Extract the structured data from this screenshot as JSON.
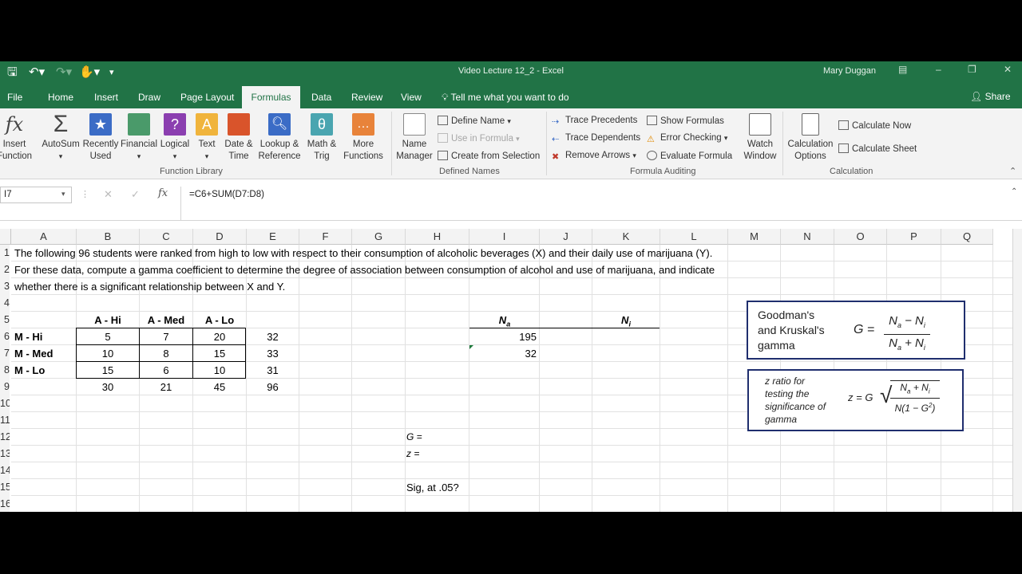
{
  "window": {
    "title": "Video Lecture 12_2 - Excel",
    "user": "Mary Duggan",
    "share_label": "Share",
    "tell_me": "Tell me what you want to do"
  },
  "tabs": [
    "File",
    "Home",
    "Insert",
    "Draw",
    "Page Layout",
    "Formulas",
    "Data",
    "Review",
    "View"
  ],
  "active_tab": "Formulas",
  "ribbon": {
    "function_library": {
      "label": "Function Library",
      "insert_function": "Insert\nFunction",
      "autosum": "AutoSum",
      "recently_used": "Recently\nUsed",
      "financial": "Financial",
      "logical": "Logical",
      "text": "Text",
      "date_time": "Date &\nTime",
      "lookup_reference": "Lookup &\nReference",
      "math_trig": "Math &\nTrig",
      "more_functions": "More\nFunctions"
    },
    "defined_names": {
      "label": "Defined Names",
      "name_manager": "Name\nManager",
      "define_name": "Define Name",
      "use_in_formula": "Use in Formula",
      "create_from_selection": "Create from Selection"
    },
    "formula_auditing": {
      "label": "Formula Auditing",
      "trace_precedents": "Trace Precedents",
      "trace_dependents": "Trace Dependents",
      "remove_arrows": "Remove Arrows",
      "show_formulas": "Show Formulas",
      "error_checking": "Error Checking",
      "evaluate_formula": "Evaluate Formula",
      "watch_window": "Watch\nWindow"
    },
    "calculation": {
      "label": "Calculation",
      "calculation_options": "Calculation\nOptions",
      "calculate_now": "Calculate Now",
      "calculate_sheet": "Calculate Sheet"
    }
  },
  "formula_bar": {
    "name_box": "I7",
    "formula": "=C6+SUM(D7:D8)",
    "fx": "fx"
  },
  "columns": [
    "A",
    "B",
    "C",
    "D",
    "E",
    "F",
    "G",
    "H",
    "I",
    "J",
    "K",
    "L",
    "M",
    "N",
    "O",
    "P",
    "Q"
  ],
  "rows": [
    "1",
    "2",
    "3",
    "4",
    "5",
    "6",
    "7",
    "8",
    "9",
    "10",
    "11",
    "12",
    "13",
    "14",
    "15",
    "16"
  ],
  "sheet": {
    "line1": "The following 96 students were ranked from high to low with respect to their consumption of alcoholic beverages (X) and their daily use of marijuana (Y).",
    "line2": "For these data, compute a gamma coefficient to determine the degree of association between consumption of alcohol and use of marijuana, and indicate",
    "line3": "whether there is a significant relationship between X and Y.",
    "col_headers": [
      "A - Hi",
      "A - Med",
      "A - Lo"
    ],
    "row_labels": [
      "M - Hi",
      "M - Med",
      "M - Lo"
    ],
    "table": [
      [
        "5",
        "7",
        "20",
        "32"
      ],
      [
        "10",
        "8",
        "15",
        "33"
      ],
      [
        "15",
        "6",
        "10",
        "31"
      ],
      [
        "30",
        "21",
        "45",
        "96"
      ]
    ],
    "na_label": "N",
    "na_sub": "a",
    "ni_label": "N",
    "ni_sub": "i",
    "na_values": [
      "195",
      "32"
    ],
    "g_label": "G =",
    "z_label": "z =",
    "sig_label": "Sig, at .05?"
  },
  "formula_images": {
    "gamma_title": "Goodman's\nand Kruskal's\ngamma",
    "gamma_formula": "G =",
    "z_title": "z ratio for\ntesting the\nsignificance of\ngamma",
    "z_formula": "z = G"
  }
}
